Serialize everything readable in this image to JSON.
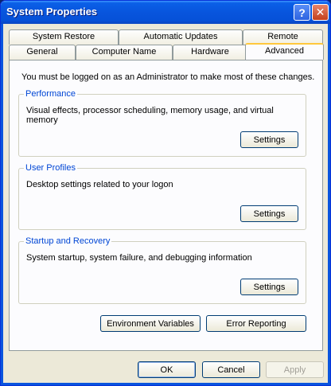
{
  "window": {
    "title": "System Properties"
  },
  "titlebar_buttons": {
    "help": "?",
    "close": "✕"
  },
  "tabs_back": [
    {
      "label": "System Restore"
    },
    {
      "label": "Automatic Updates"
    },
    {
      "label": "Remote"
    }
  ],
  "tabs_front": [
    {
      "label": "General"
    },
    {
      "label": "Computer Name"
    },
    {
      "label": "Hardware"
    },
    {
      "label": "Advanced"
    }
  ],
  "active_tab": "Advanced",
  "advanced": {
    "admin_note": "You must be logged on as an Administrator to make most of these changes.",
    "performance": {
      "title": "Performance",
      "description": "Visual effects, processor scheduling, memory usage, and virtual memory",
      "button": "Settings"
    },
    "user_profiles": {
      "title": "User Profiles",
      "description": "Desktop settings related to your logon",
      "button": "Settings"
    },
    "startup_recovery": {
      "title": "Startup and Recovery",
      "description": "System startup, system failure, and debugging information",
      "button": "Settings"
    },
    "environment_variables": "Environment Variables",
    "error_reporting": "Error Reporting"
  },
  "footer": {
    "ok": "OK",
    "cancel": "Cancel",
    "apply": "Apply"
  },
  "colors": {
    "title_gradient": "#0855dd",
    "group_title": "#0046d5",
    "active_tab_accent": "#ffc83c"
  }
}
